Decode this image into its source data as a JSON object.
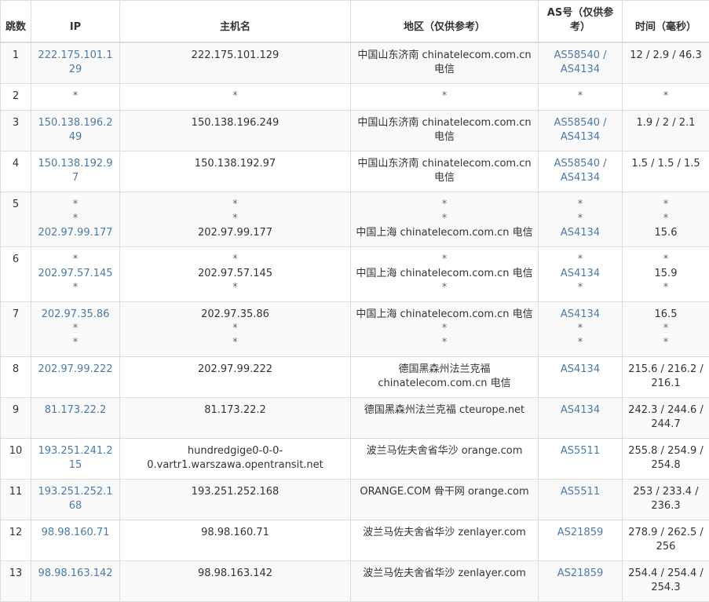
{
  "table": {
    "headers": {
      "hop": "跳数",
      "ip": "IP",
      "hostname": "主机名",
      "region": "地区（仅供参考）",
      "as": "AS号（仅供参考）",
      "time": "时间（毫秒）"
    },
    "rows": [
      {
        "hop": "1",
        "ip": [
          "222.175.101.129"
        ],
        "hostname": [
          "222.175.101.129"
        ],
        "region": [
          "中国山东济南 chinatelecom.com.cn 电信"
        ],
        "as": [
          "AS58540 / AS4134"
        ],
        "time": [
          "12 / 2.9 / 46.3"
        ]
      },
      {
        "hop": "2",
        "ip": [
          "*"
        ],
        "hostname": [
          "*"
        ],
        "region": [
          "*"
        ],
        "as": [
          "*"
        ],
        "time": [
          "*"
        ]
      },
      {
        "hop": "3",
        "ip": [
          "150.138.196.249"
        ],
        "hostname": [
          "150.138.196.249"
        ],
        "region": [
          "中国山东济南 chinatelecom.com.cn 电信"
        ],
        "as": [
          "AS58540 / AS4134"
        ],
        "time": [
          "1.9 / 2 / 2.1"
        ]
      },
      {
        "hop": "4",
        "ip": [
          "150.138.192.97"
        ],
        "hostname": [
          "150.138.192.97"
        ],
        "region": [
          "中国山东济南 chinatelecom.com.cn 电信"
        ],
        "as": [
          "AS58540 / AS4134"
        ],
        "time": [
          "1.5 / 1.5 / 1.5"
        ]
      },
      {
        "hop": "5",
        "ip": [
          "*",
          "*",
          "202.97.99.177"
        ],
        "hostname": [
          "*",
          "*",
          "202.97.99.177"
        ],
        "region": [
          "*",
          "*",
          "中国上海 chinatelecom.com.cn 电信"
        ],
        "as": [
          "*",
          "*",
          "AS4134"
        ],
        "time": [
          "*",
          "*",
          "15.6"
        ]
      },
      {
        "hop": "6",
        "ip": [
          "*",
          "202.97.57.145",
          "*"
        ],
        "hostname": [
          "*",
          "202.97.57.145",
          "*"
        ],
        "region": [
          "*",
          "中国上海 chinatelecom.com.cn 电信",
          "*"
        ],
        "as": [
          "*",
          "AS4134",
          "*"
        ],
        "time": [
          "*",
          "15.9",
          "*"
        ]
      },
      {
        "hop": "7",
        "ip": [
          "202.97.35.86",
          "*",
          "*"
        ],
        "hostname": [
          "202.97.35.86",
          "*",
          "*"
        ],
        "region": [
          "中国上海 chinatelecom.com.cn 电信",
          "*",
          "*"
        ],
        "as": [
          "AS4134",
          "*",
          "*"
        ],
        "time": [
          "16.5",
          "*",
          "*"
        ]
      },
      {
        "hop": "8",
        "ip": [
          "202.97.99.222"
        ],
        "hostname": [
          "202.97.99.222"
        ],
        "region": [
          "德国黑森州法兰克福 chinatelecom.com.cn 电信"
        ],
        "as": [
          "AS4134"
        ],
        "time": [
          "215.6 / 216.2 / 216.1"
        ]
      },
      {
        "hop": "9",
        "ip": [
          "81.173.22.2"
        ],
        "hostname": [
          "81.173.22.2"
        ],
        "region": [
          "德国黑森州法兰克福 cteurope.net"
        ],
        "as": [
          "AS4134"
        ],
        "time": [
          "242.3 / 244.6 / 244.7"
        ]
      },
      {
        "hop": "10",
        "ip": [
          "193.251.241.215"
        ],
        "hostname": [
          "hundredgige0-0-0-0.vartr1.warszawa.opentransit.net"
        ],
        "region": [
          "波兰马佐夫舍省华沙 orange.com"
        ],
        "as": [
          "AS5511"
        ],
        "time": [
          "255.8 / 254.9 / 254.8"
        ]
      },
      {
        "hop": "11",
        "ip": [
          "193.251.252.168"
        ],
        "hostname": [
          "193.251.252.168"
        ],
        "region": [
          "ORANGE.COM 骨干网 orange.com"
        ],
        "as": [
          "AS5511"
        ],
        "time": [
          "253 / 233.4 / 236.3"
        ]
      },
      {
        "hop": "12",
        "ip": [
          "98.98.160.71"
        ],
        "hostname": [
          "98.98.160.71"
        ],
        "region": [
          "波兰马佐夫舍省华沙 zenlayer.com"
        ],
        "as": [
          "AS21859"
        ],
        "time": [
          "278.9 / 262.5 / 256"
        ]
      },
      {
        "hop": "13",
        "ip": [
          "98.98.163.142"
        ],
        "hostname": [
          "98.98.163.142"
        ],
        "region": [
          "波兰马佐夫舍省华沙 zenlayer.com"
        ],
        "as": [
          "AS21859"
        ],
        "time": [
          "254.4 / 254.4 / 254.3"
        ]
      }
    ]
  },
  "colors": {
    "link": "#4a7aa8",
    "text": "#333333",
    "border": "#dddddd",
    "stripe": "#f9f9f9"
  }
}
